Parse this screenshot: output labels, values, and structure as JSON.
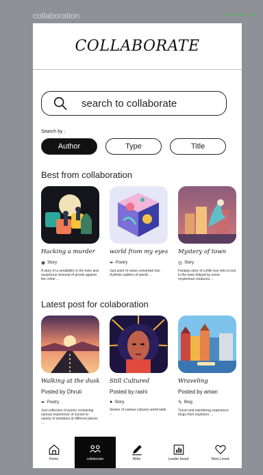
{
  "frame_label": "collaboration",
  "header": {
    "title": "COLLABORATE"
  },
  "search": {
    "placeholder": "search to collaborate"
  },
  "search_by": {
    "label": "Search by :",
    "options": [
      "Author",
      "Type",
      "Title"
    ],
    "selected": "Author"
  },
  "best": {
    "title": "Best from collaboration",
    "items": [
      {
        "title": "Hacking a murder",
        "tag": "Story",
        "tag_icon": "story-icon",
        "desc": "A story of a serialkiller in the town and suspicious removal of proofs against the crime ..."
      },
      {
        "title": "world from my eyes",
        "tag": "Poetry",
        "tag_icon": "quill-icon",
        "desc": "Just point of views converted into rhythmic pattern of words ..."
      },
      {
        "title": "Mystery of town",
        "tag": "Story",
        "tag_icon": "story-icon",
        "desc": "Fantasy story of a little boy who is lost in the town helped by some mysterious creatures ..."
      }
    ]
  },
  "latest": {
    "title": "Latest post for colaboration",
    "items": [
      {
        "title": "Walking at the dusk",
        "posted_by": "Posted by Dhruti",
        "tag": "Poetry",
        "tag_icon": "quill-icon",
        "desc": "Just collection of poetry containing various experience of sunset to variety of emotions at different places ..."
      },
      {
        "title": "Still Cultured",
        "posted_by": "Posted by rashi",
        "tag": "Story",
        "tag_icon": "story-icon",
        "desc": "Stories of various cultures world wide ..."
      },
      {
        "title": "Wraveling",
        "posted_by": "Posted by aman",
        "tag": "Blog",
        "tag_icon": "blog-icon",
        "desc": "Travel and wondering experience blogs from explorers ..."
      }
    ]
  },
  "nav": {
    "items": [
      {
        "label": "Home",
        "icon": "home-icon"
      },
      {
        "label": "collaborate",
        "icon": "people-icon"
      },
      {
        "label": "Write",
        "icon": "pencil-icon"
      },
      {
        "label": "Leader board",
        "icon": "chart-icon"
      },
      {
        "label": "Most Loved",
        "icon": "heart-icon"
      }
    ],
    "active": "collaborate"
  }
}
